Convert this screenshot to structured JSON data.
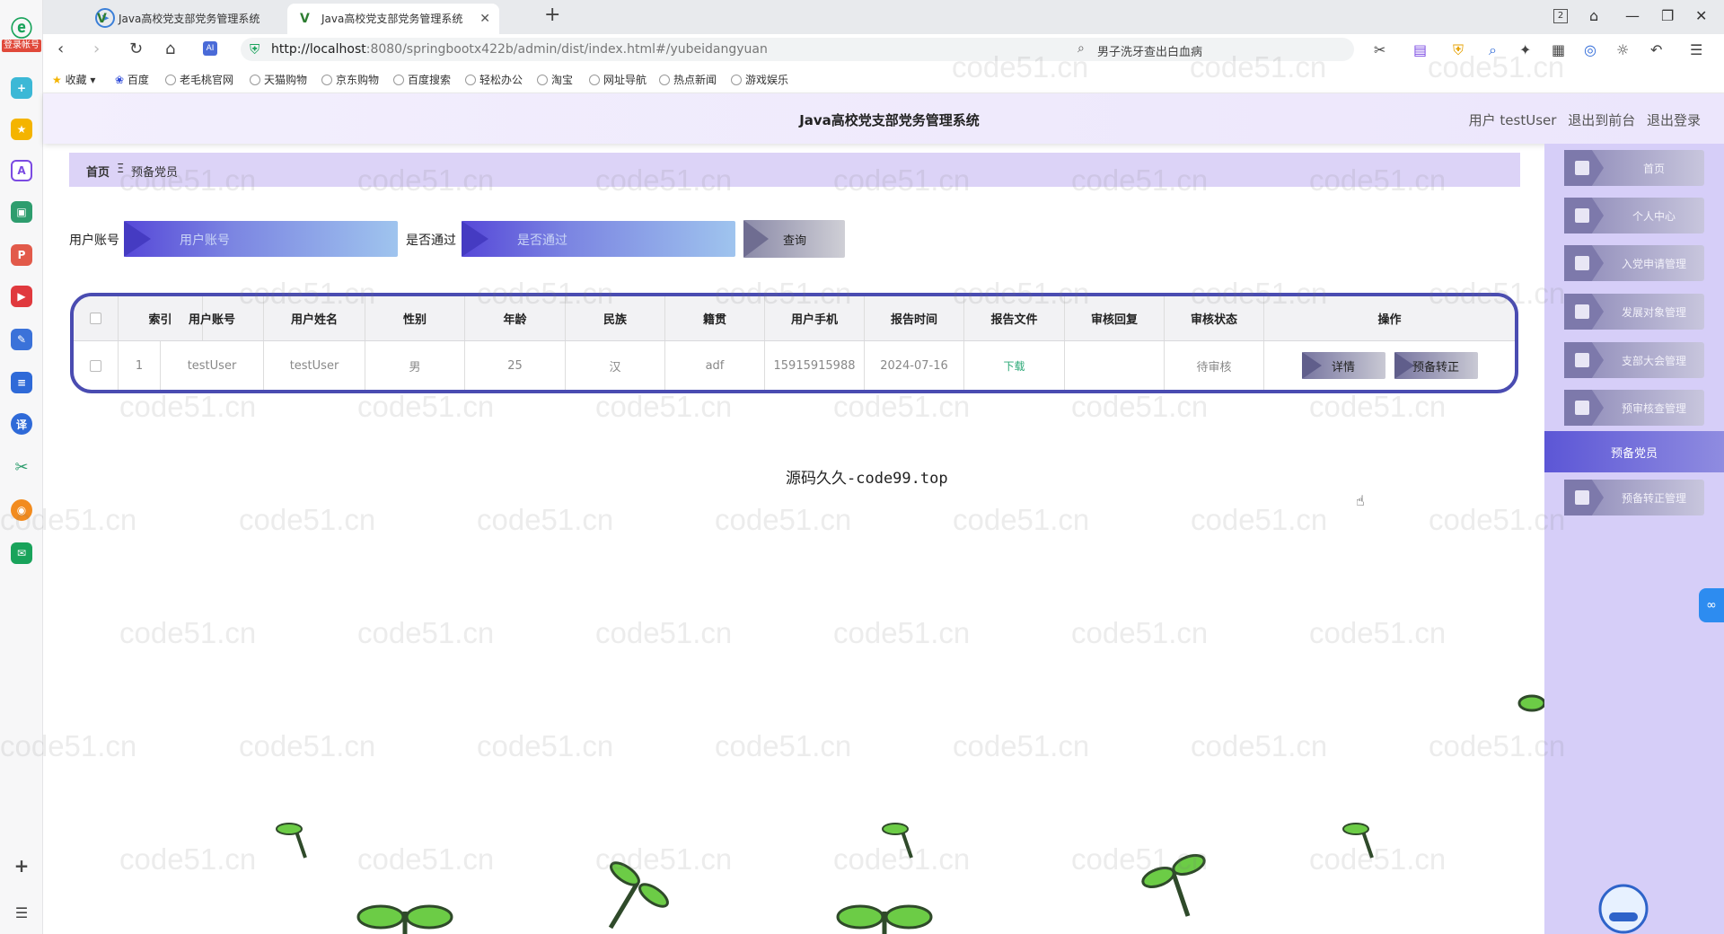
{
  "browser": {
    "tabs": [
      {
        "title": "Java高校党支部党务管理系统"
      },
      {
        "title": "Java高校党支部党务管理系统"
      }
    ],
    "login_badge": "登录帐号",
    "url_host": "http://localhost",
    "url_rest": ":8080/springbootx422b/admin/dist/index.html#/yubeidangyuan",
    "search_text": "男子洗牙查出白血病",
    "bookmarks": [
      "收藏",
      "百度",
      "老毛桃官网",
      "天猫购物",
      "京东购物",
      "百度搜索",
      "轻松办公",
      "淘宝",
      "网址导航",
      "热点新闻",
      "游戏娱乐"
    ],
    "tab_count_badge": "2"
  },
  "header": {
    "title": "Java高校党支部党务管理系统",
    "user_label": "用户 testUser",
    "front_link": "退出到前台",
    "logout_link": "退出登录"
  },
  "breadcrumb": {
    "home": "首页",
    "sep": "Ξ",
    "current": "预备党员"
  },
  "search": {
    "account_label": "用户账号",
    "account_placeholder": "用户账号",
    "passed_label": "是否通过",
    "passed_placeholder": "是否通过",
    "query_button": "查询"
  },
  "table": {
    "headers": [
      "索引",
      "用户账号",
      "用户姓名",
      "性别",
      "年龄",
      "民族",
      "籍贯",
      "用户手机",
      "报告时间",
      "报告文件",
      "审核回复",
      "审核状态",
      "操作"
    ],
    "rows": [
      {
        "index": "1",
        "account": "testUser",
        "name": "testUser",
        "gender": "男",
        "age": "25",
        "ethnicity": "汉",
        "origin": "adf",
        "phone": "15915915988",
        "report_time": "2024-07-16",
        "report_file": "下载",
        "review_reply": "",
        "review_status": "待审核",
        "detail_button": "详情",
        "convert_button": "预备转正"
      }
    ]
  },
  "footer": "源码久久-code99.top",
  "sidebar": {
    "items": [
      {
        "label": "首页"
      },
      {
        "label": "个人中心"
      },
      {
        "label": "入党申请管理"
      },
      {
        "label": "发展对象管理"
      },
      {
        "label": "支部大会管理"
      },
      {
        "label": "预审核查管理"
      },
      {
        "label": "预备党员"
      },
      {
        "label": "预备转正管理"
      }
    ]
  },
  "watermark": "code51.cn",
  "colors": {
    "accent": "#5648d8",
    "table_border": "#4a4cb1",
    "sidebar_bg": "#d6cef8",
    "active_menu": "#5c56d6",
    "download_link": "#2aa876"
  }
}
